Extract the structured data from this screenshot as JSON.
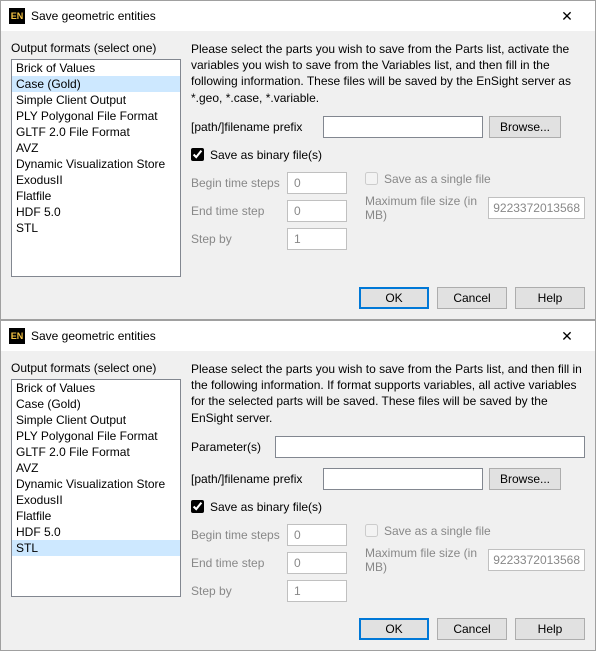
{
  "dialog1": {
    "title": "Save geometric entities",
    "section_label": "Output formats (select one)",
    "formats": [
      "Brick of Values",
      "Case (Gold)",
      "Simple Client Output",
      "PLY Polygonal File Format",
      "GLTF 2.0 File Format",
      "AVZ",
      "Dynamic Visualization Store",
      "ExodusII",
      "Flatfile",
      "HDF 5.0",
      "STL"
    ],
    "selected_index": 1,
    "instructions": "Please select the parts you wish to save from the Parts list, activate the variables you wish to save from the Variables list, and then fill in the following information. These files will be saved by the EnSight server as *.geo, *.case, *.variable.",
    "prefix_label": "[path/]filename prefix",
    "prefix_value": "",
    "browse": "Browse...",
    "save_binary": "Save as binary file(s)",
    "save_binary_checked": true,
    "begin_label": "Begin time steps",
    "begin_val": "0",
    "end_label": "End time step",
    "end_val": "0",
    "step_label": "Step by",
    "step_val": "1",
    "single_file": "Save as a single file",
    "single_file_checked": false,
    "maxsize_label": "Maximum file size (in MB)",
    "maxsize_val": "9223372013568",
    "ok": "OK",
    "cancel": "Cancel",
    "help": "Help"
  },
  "dialog2": {
    "title": "Save geometric entities",
    "section_label": "Output formats (select one)",
    "formats": [
      "Brick of Values",
      "Case (Gold)",
      "Simple Client Output",
      "PLY Polygonal File Format",
      "GLTF 2.0 File Format",
      "AVZ",
      "Dynamic Visualization Store",
      "ExodusII",
      "Flatfile",
      "HDF 5.0",
      "STL"
    ],
    "selected_index": 10,
    "instructions": "Please select the parts you wish to save from the Parts list, and then fill in the following information.  If format supports variables, all active variables for the selected parts will be saved. These files will be saved by the EnSight server.",
    "param_label": "Parameter(s)",
    "param_value": "",
    "prefix_label": "[path/]filename prefix",
    "prefix_value": "",
    "browse": "Browse...",
    "save_binary": "Save as binary file(s)",
    "save_binary_checked": true,
    "begin_label": "Begin time steps",
    "begin_val": "0",
    "end_label": "End time step",
    "end_val": "0",
    "step_label": "Step by",
    "step_val": "1",
    "single_file": "Save as a single file",
    "single_file_checked": false,
    "maxsize_label": "Maximum file size (in MB)",
    "maxsize_val": "9223372013568",
    "ok": "OK",
    "cancel": "Cancel",
    "help": "Help"
  }
}
